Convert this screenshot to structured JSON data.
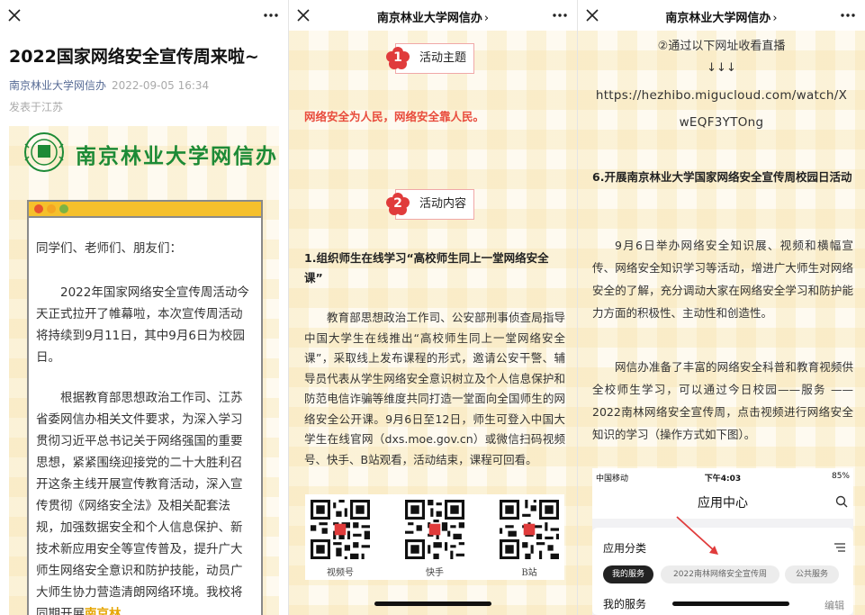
{
  "panel1": {
    "article_title": "2022国家网络安全宣传周来啦~",
    "account_name": "南京林业大学网信办",
    "publish_date": "2022-09-05 16:34",
    "location": "发表于江苏",
    "banner_text": "南京林业大学网信办",
    "greeting": "同学们、老师们、朋友们：",
    "para1": "2022年国家网络安全宣传周活动今天正式拉开了帷幕啦，本次宣传周活动将持续到9月11日，其中9月6日为校园日。",
    "para2": "根据教育部思想政治工作司、江苏省委网信办相关文件要求，为深入学习贯彻习近平总书记关于网络强国的重要思想，紧紧围绕迎接党的二十大胜利召开这条主线开展宣传教育活动，深入宣传贯彻《网络安全法》及相关配套法规，加强数据安全和个人信息保护、新技术新应用安全等宣传普及，提升广大师生网络安全意识和防护技能，动员广大师生协力营造清朗网络环境。我校将同期开展",
    "para2_highlight": "南京林"
  },
  "panel2": {
    "nav_title": "南京林业大学网信办",
    "badge1_num": "1",
    "badge1_label": "活动主题",
    "slogan": "网络安全为人民，网络安全靠人民。",
    "badge2_num": "2",
    "badge2_label": "活动内容",
    "section1_title": "1.组织师生在线学习“高校师生同上一堂网络安全课”",
    "section1_text": "教育部思想政治工作司、公安部刑事侦查局指导中国大学生在线推出“高校师生同上一堂网络安全课”，采取线上发布课程的形式，邀请公安干警、辅导员代表从学生网络安全意识树立及个人信息保护和防范电信诈骗等维度共同打造一堂面向全国师生的网络安全公开课。9月6日至12日，师生可登入中国大学生在线官网（dxs.moe.gov.cn）或微信扫码视频号、快手、B站观看，活动结束，课程可回看。",
    "qr_labels": [
      "视频号",
      "快手",
      "B站"
    ]
  },
  "panel3": {
    "nav_title": "南京林业大学网信办",
    "live_line": "②通过以下网址收看直播",
    "arrows": "↓↓↓",
    "url_line1": "https://hezhibo.migucloud.com/watch/X",
    "url_line2": "wEQF3YTOng",
    "section6_title": "6.开展南京林业大学国家网络安全宣传周校园日活动",
    "para_a": "9月6日举办网络安全知识展、视频和横幅宣传、网络安全知识学习等活动，增进广大师生对网络安全的了解，充分调动大家在网络安全学习和防护能力方面的积极性、主动性和创造性。",
    "para_b": "网信办准备了丰富的网络安全科普和教育视频供全校师生学习，可以通过今日校园——服务 ——2022南林网络安全宣传周，点击视频进行网络安全知识的学习（操作方式如下图）。",
    "phone": {
      "carrier": "中国移动",
      "time": "下午4:03",
      "battery": "85%",
      "app_title": "应用中心",
      "category_title": "应用分类",
      "chips": [
        "我的服务",
        "2022南林网络安全宣传周",
        "公共服务"
      ],
      "my_services": "我的服务",
      "edit": "编辑"
    }
  },
  "colors": {
    "accent_green": "#1c8a36",
    "slogan_red": "#e84c3d",
    "badge_red": "#e03b3b",
    "link_blue": "#576b95",
    "highlight_gold": "#e6a500"
  }
}
